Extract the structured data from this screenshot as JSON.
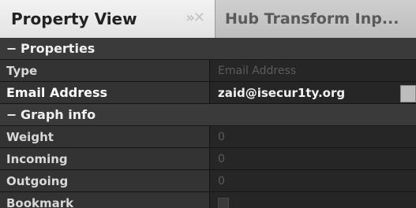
{
  "tabs": {
    "active": "Property View",
    "active_controls": "»✕",
    "inactive": "Hub Transform Inp..."
  },
  "sections": {
    "properties": "Properties",
    "graph_info": "Graph info",
    "toggle": "−"
  },
  "properties": {
    "type": {
      "key": "Type",
      "value": "Email Address"
    },
    "email": {
      "key": "Email Address",
      "value": "zaid@isecur1ty.org"
    }
  },
  "graph_info": {
    "weight": {
      "key": "Weight",
      "value": "0"
    },
    "incoming": {
      "key": "Incoming",
      "value": "0"
    },
    "outgoing": {
      "key": "Outgoing",
      "value": "0"
    },
    "bookmark": {
      "key": "Bookmark",
      "checked": false
    }
  }
}
